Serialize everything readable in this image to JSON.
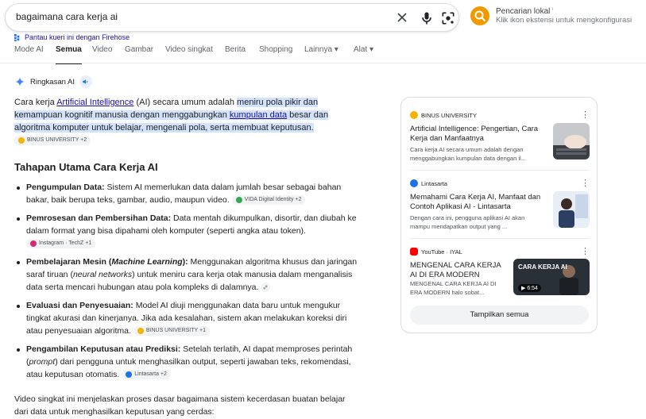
{
  "search": {
    "query": "bagaimana cara kerja ai"
  },
  "local_search": {
    "title": "Pencarian lokal",
    "info_mark": "ⁱ",
    "subtitle": "Klik ikon ekstensi untuk mengkonfigurasi"
  },
  "firehose": {
    "label": "Pantau kueri ini dengan Firehose"
  },
  "tabs": [
    {
      "label": "Mode AI",
      "active": false
    },
    {
      "label": "Semua",
      "active": true
    },
    {
      "label": "Video",
      "active": false
    },
    {
      "label": "Gambar",
      "active": false
    },
    {
      "label": "Video singkat",
      "active": false
    },
    {
      "label": "Berita",
      "active": false
    },
    {
      "label": "Shopping",
      "active": false
    },
    {
      "label": "Lainnya ▾",
      "active": false
    },
    {
      "label": "Alat ▾",
      "active": false
    }
  ],
  "ai_overview": {
    "label": "Ringkasan AI",
    "intro": {
      "p1": "Cara kerja ",
      "link1": "Artificial Intelligence",
      "p2": " (AI) secara umum adalah ",
      "hl1": "meniru pola pikir dan kemampuan kognitif manusia dengan menggabungkan ",
      "link2": "kumpulan data",
      "hl2": " besar dan algoritma komputer untuk belajar, mengenali pola, serta membuat keputusan.",
      "chip": "BINUS UNIVERSITY +2"
    },
    "subheading": "Tahapan Utama Cara Kerja AI",
    "steps": [
      {
        "bold": "Pengumpulan Data:",
        "text": " Sistem AI memerlukan data dalam jumlah besar sebagai bahan bakar, baik berupa teks, gambar, audio, maupun video.",
        "chip": "VIDA Digital Identity +2"
      },
      {
        "bold": "Pemrosesan dan Pembersihan Data:",
        "text": " Data mentah dikumpulkan, disortir, dan diubah ke dalam format yang bisa dipahami oleh komputer (seperti angka atau token).",
        "chip": "Instagram · TechZ +1"
      },
      {
        "bold_a": "Pembelajaran Mesin (",
        "bold_i": "Machine Learning",
        "bold_b": "):",
        "text_a": " Menggunakan algoritma khusus dan jaringan saraf tiruan (",
        "text_i": "neural networks",
        "text_b": ") untuk meniru cara kerja otak manusia dalam menganalisis data serta mencari hubungan atau pola kompleks di dalamnya."
      },
      {
        "bold": "Evaluasi dan Penyesuaian:",
        "text": " Model AI diuji menggunakan data baru untuk mengukur tingkat akurasi dan kinerjanya. Jika ada kesalahan, sistem akan melakukan koreksi diri atau penyesuaian algoritma.",
        "chip": "BINUS UNIVERSITY +1"
      },
      {
        "bold": "Pengambilan Keputusan atau Prediksi:",
        "text_a": " Setelah terlatih, AI dapat memproses perintah (",
        "text_i": "prompt",
        "text_b": ") dari pengguna untuk menghasilkan output, seperti jawaban teks, rekomendasi, atau keputusan otomatis.",
        "chip": "Lintasarta +2"
      }
    ],
    "video_intro": "Video singkat ini menjelaskan proses dasar bagaimana sistem kecerdasan buatan belajar dari data untuk menghasilkan keputusan yang cerdas:"
  },
  "sources": [
    {
      "site": "BINUS UNIVERSITY",
      "title": "Artificial Intelligence: Pengertian, Cara Kerja dan Manfaatnya",
      "snippet": "Cara kerja AI secara umum adalah dengan menggabungkan kumpulan data dengan il..."
    },
    {
      "site": "Lintasarta",
      "title": "Memahami Cara Kerja AI, Manfaat dan Contoh Aplikasi AI - Lintasarta",
      "snippet": "Dengan cara ini, pengguna aplikasi AI akan mampu mendapatkan output yang ..."
    },
    {
      "site": "YouTube · IYAL",
      "title": "MENGENAL CARA KERJA AI DI ERA MODERN",
      "snippet": "MENGENAL CARA KERJA AI DI ERA MODERN halo sobat...",
      "duration": "6:54",
      "thumb_text": "CARA KERJA AI"
    }
  ],
  "show_all": "Tampilkan semua",
  "colors": {
    "accent": "#1a0dab",
    "highlight": "#d3e3fd",
    "local_badge": "#f29900"
  }
}
